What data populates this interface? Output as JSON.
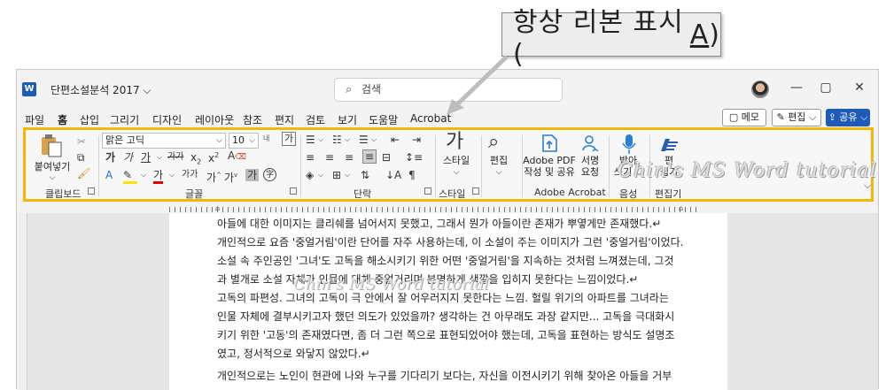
{
  "callout": {
    "text_pre": "항상 리본 표시(",
    "text_key": "A",
    "text_post": ")"
  },
  "titlebar": {
    "doc_title": "단편소설분석 2017 ⌵",
    "search_placeholder": "검색"
  },
  "window_controls": {
    "minimize": "—",
    "restore": "▢",
    "close": "✕"
  },
  "menu": [
    "파일",
    "홈",
    "삽입",
    "그리기",
    "디자인",
    "레이아웃",
    "참조",
    "편지",
    "검토",
    "보기",
    "도움말",
    "Acrobat"
  ],
  "actions": {
    "memo": "▢ 메모",
    "edit": "✎ 편집 ⌵",
    "share": "⇪ 공유 ⌵"
  },
  "ribbon": {
    "clipboard": {
      "paste": "붙여넣기",
      "paste_arrow": "⌵",
      "label": "클립보드"
    },
    "font": {
      "name": "맑은 고딕",
      "size": "10",
      "grow": "내",
      "shrink": "가",
      "label": "글꼴"
    },
    "paragraph": {
      "label": "단락"
    },
    "styles": {
      "button": "스타일",
      "label": "스타일"
    },
    "editing": {
      "button": "편집"
    },
    "acrobat": {
      "create": "Adobe PDF\n작성 및 공유",
      "sign": "서명\n요청",
      "label": "Adobe Acrobat"
    },
    "voice": {
      "dictate": "받아\n쓰기 ⌵",
      "label": "음성"
    },
    "editor": {
      "button": "편\n집기",
      "label": "편집기"
    },
    "watermark": "Chin's MS Word tutorial",
    "collapse": "⌵"
  },
  "document": {
    "paragraphs": [
      "아들에 대한 이미지는 클리쉐를 넘어서지 못했고, 그래서 뭔가 아들이란 존재가 뿌옇게만 존재했다.↵",
      "개인적으로 요즘 '중얼거림'이란 단어를 자주 사용하는데, 이 소설이 주는 이미지가 그런 '중얼거림'이었다.",
      "소설 속 주인공인 '그녀'도 고독을 해소시키기 위한 어떤 '중얼거림'을 지속하는 것처럼 느껴졌는데, 그것",
      "과 별개로 소설 자체가 인물에 대해 중얼거리며 분명하게 색깔을 입히지 못한다는 느낌이었다.↵",
      "고독의 파편성. 그녀의 고독이 극 안에서 잘 어우러지지 못한다는 느낌. 헐릴 위기의 아파트를 그녀라는",
      "인물 자체에 결부시키고자 했던 의도가 있었을까? 생각하는 건 아무래도 과장 같지만... 고독을 극대화시",
      "키기 위한 '고동'의 존재였다면, 좀 더 그런 쪽으로 표현되었어야 했는데, 고독을 표현하는 방식도 설명조",
      "였고, 정서적으로 와닿지 않았다.↵",
      "개인적으로는 노인이 현관에 나와 누구를 기다리기 보다는, 자신을 이전시키기 위해 찾아온 아들을 거부"
    ],
    "watermark": "Chin's MS Word tutorial"
  }
}
